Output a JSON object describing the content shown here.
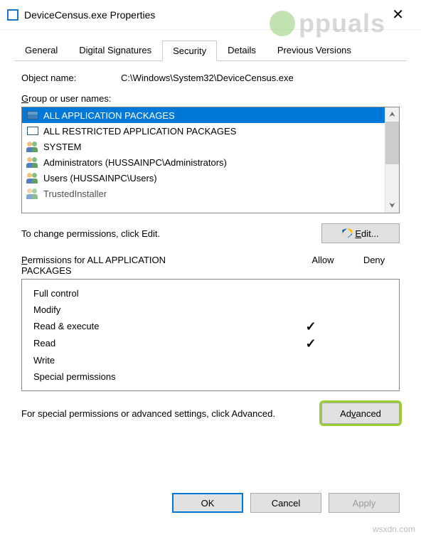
{
  "window": {
    "title": "DeviceCensus.exe Properties"
  },
  "watermark": "ppuals",
  "source_watermark": "wsxdn.com",
  "tabs": [
    "General",
    "Digital Signatures",
    "Security",
    "Details",
    "Previous Versions"
  ],
  "active_tab": "Security",
  "object": {
    "label": "Object name:",
    "value": "C:\\Windows\\System32\\DeviceCensus.exe"
  },
  "group_label": "Group or user names:",
  "groups": [
    {
      "name": "ALL APPLICATION PACKAGES",
      "icon": "package",
      "selected": true
    },
    {
      "name": "ALL RESTRICTED APPLICATION PACKAGES",
      "icon": "package-outline",
      "selected": false
    },
    {
      "name": "SYSTEM",
      "icon": "users",
      "selected": false
    },
    {
      "name": "Administrators (HUSSAINPC\\Administrators)",
      "icon": "users",
      "selected": false
    },
    {
      "name": "Users (HUSSAINPC\\Users)",
      "icon": "users",
      "selected": false
    },
    {
      "name": "TrustedInstaller",
      "icon": "user",
      "selected": false
    }
  ],
  "edit_hint": "To change permissions, click Edit.",
  "edit_button": "Edit...",
  "perms": {
    "label": "Permissions for ALL APPLICATION PACKAGES",
    "columns": [
      "Allow",
      "Deny"
    ],
    "rows": [
      {
        "name": "Full control",
        "allow": false,
        "deny": false
      },
      {
        "name": "Modify",
        "allow": false,
        "deny": false
      },
      {
        "name": "Read & execute",
        "allow": true,
        "deny": false
      },
      {
        "name": "Read",
        "allow": true,
        "deny": false
      },
      {
        "name": "Write",
        "allow": false,
        "deny": false
      },
      {
        "name": "Special permissions",
        "allow": false,
        "deny": false
      }
    ]
  },
  "advanced": {
    "text": "For special permissions or advanced settings, click Advanced.",
    "button": "Advanced"
  },
  "footer": {
    "ok": "OK",
    "cancel": "Cancel",
    "apply": "Apply"
  }
}
